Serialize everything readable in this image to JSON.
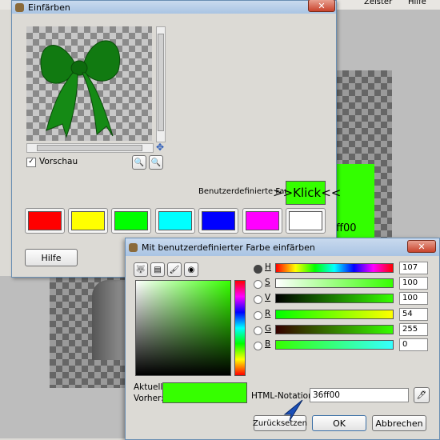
{
  "background": {
    "menu_items": [
      "Zeister",
      "Hilfe"
    ],
    "canvas_text": "ff00"
  },
  "colorize_dialog": {
    "title": "Einfärben",
    "preview_checkbox_label": "Vorschau",
    "custom_color_label": "Benutzerdefinierte Farbe",
    "annotation_text": ">>Klick<<",
    "help_button": "Hilfe",
    "swatches": [
      "#ff0000",
      "#ffff00",
      "#00ff00",
      "#00ffff",
      "#0000ff",
      "#ff00ff",
      "#ffffff"
    ],
    "custom_color": "#36ff00"
  },
  "color_dialog": {
    "title": "Mit benutzerdefinierter Farbe einfärben",
    "channels": [
      {
        "key": "H",
        "value": "107"
      },
      {
        "key": "S",
        "value": "100"
      },
      {
        "key": "V",
        "value": "100"
      },
      {
        "key": "R",
        "value": "54"
      },
      {
        "key": "G",
        "value": "255"
      },
      {
        "key": "B",
        "value": "0"
      }
    ],
    "current_label": "Aktuell:",
    "previous_label": "Vorher:",
    "html_label": "HTML-Notation:",
    "html_value": "36ff00",
    "current_color": "#36ff00",
    "reset_button": "Zurücksetzen",
    "ok_button": "OK",
    "cancel_button": "Abbrechen"
  }
}
